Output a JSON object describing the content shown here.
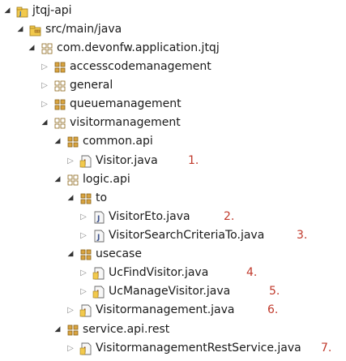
{
  "tree": {
    "project": "jtqj-api",
    "src_folder": "src/main/java",
    "root_package": "com.devonfw.application.jtqj",
    "packages": [
      "accesscodemanagement",
      "general",
      "queuemanagement",
      "visitormanagement"
    ],
    "common_api": "common.api",
    "visitor_java": "Visitor.java",
    "logic_api": "logic.api",
    "to": "to",
    "visitor_eto": "VisitorEto.java",
    "visitor_search": "VisitorSearchCriteriaTo.java",
    "usecase": "usecase",
    "uc_find": "UcFindVisitor.java",
    "uc_manage": "UcManageVisitor.java",
    "visitormanagement_java": "Visitormanagement.java",
    "service_rest": "service.api.rest",
    "rest_service": "VisitormanagementRestService.java"
  },
  "annotations": [
    "1.",
    "2.",
    "3.",
    "4.",
    "5.",
    "6.",
    "7."
  ],
  "colors": {
    "annotation": "#c0392b",
    "package_icon": "#b8860b",
    "interface_icon": "#8b5a2b",
    "class_icon": "#6a5acd"
  }
}
